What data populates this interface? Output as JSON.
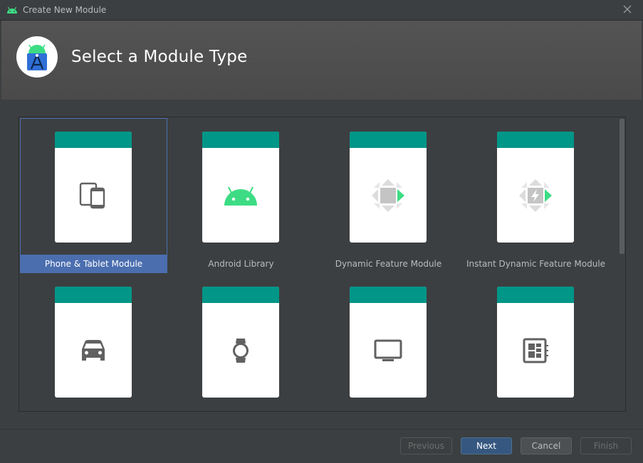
{
  "window": {
    "title": "Create New Module",
    "app_icon": "android-icon",
    "close_icon": "close-icon"
  },
  "header": {
    "title": "Select a Module Type",
    "logo": "android-studio-icon"
  },
  "gallery": {
    "items": [
      {
        "label": "Phone & Tablet Module",
        "icon": "phone-tablet-icon",
        "selected": true
      },
      {
        "label": "Android Library",
        "icon": "android-icon",
        "selected": false
      },
      {
        "label": "Dynamic Feature Module",
        "icon": "dynamic-feature-icon",
        "selected": false
      },
      {
        "label": "Instant Dynamic Feature Module",
        "icon": "instant-dynamic-feature-icon",
        "selected": false
      },
      {
        "label": "",
        "icon": "car-icon",
        "selected": false
      },
      {
        "label": "",
        "icon": "watch-icon",
        "selected": false
      },
      {
        "label": "",
        "icon": "tv-icon",
        "selected": false
      },
      {
        "label": "",
        "icon": "things-board-icon",
        "selected": false
      }
    ]
  },
  "buttons": {
    "previous": "Previous",
    "next": "Next",
    "cancel": "Cancel",
    "finish": "Finish"
  },
  "colors": {
    "accent_band": "#009688",
    "selection": "#4b6eaf",
    "android_green": "#3ddc84",
    "default_button": "#365880"
  }
}
